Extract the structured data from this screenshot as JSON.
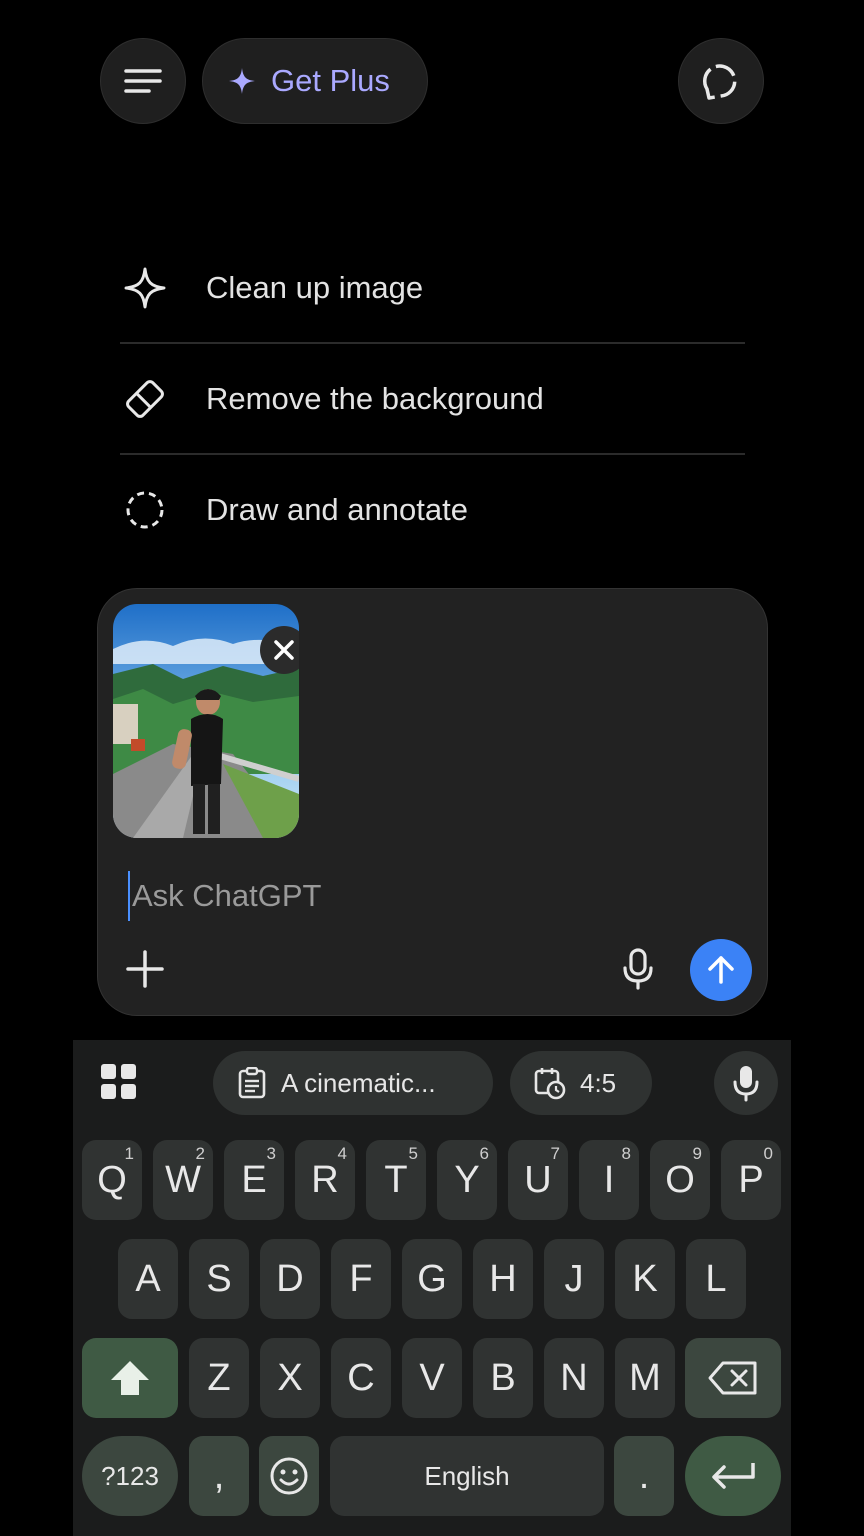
{
  "header": {
    "get_plus_label": "Get Plus",
    "menu_icon": "menu-icon",
    "new_chat_icon": "new-chat-icon",
    "accent": "#aaa9ff"
  },
  "suggestions": [
    {
      "label": "Clean up image",
      "icon": "sparkle-icon"
    },
    {
      "label": "Remove the background",
      "icon": "eraser-icon"
    },
    {
      "label": "Draw and annotate",
      "icon": "dashed-circle-icon"
    }
  ],
  "composer": {
    "placeholder": "Ask ChatGPT",
    "attachment_alt": "photo of a man on a road",
    "send_color": "#3b82f6"
  },
  "keyboard": {
    "clipboard_chip": "A cinematic...",
    "ratio_chip": "4:5",
    "row1": [
      {
        "k": "Q",
        "h": "1"
      },
      {
        "k": "W",
        "h": "2"
      },
      {
        "k": "E",
        "h": "3"
      },
      {
        "k": "R",
        "h": "4"
      },
      {
        "k": "T",
        "h": "5"
      },
      {
        "k": "Y",
        "h": "6"
      },
      {
        "k": "U",
        "h": "7"
      },
      {
        "k": "I",
        "h": "8"
      },
      {
        "k": "O",
        "h": "9"
      },
      {
        "k": "P",
        "h": "0"
      }
    ],
    "row2": [
      "A",
      "S",
      "D",
      "F",
      "G",
      "H",
      "J",
      "K",
      "L"
    ],
    "row3": [
      "Z",
      "X",
      "C",
      "V",
      "B",
      "N",
      "M"
    ],
    "symbols_label": "?123",
    "comma_label": ",",
    "space_label": "English",
    "period_label": "."
  }
}
